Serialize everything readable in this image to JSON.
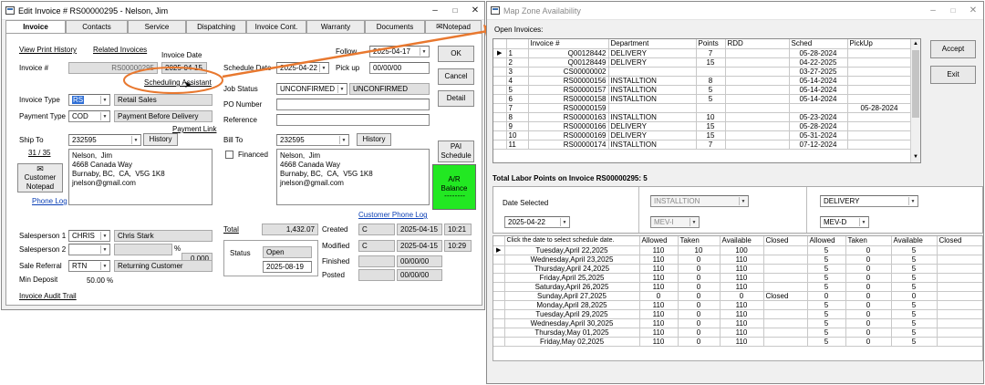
{
  "invoice_window": {
    "title": "Edit Invoice # RS00000295  -  Nelson, Jim",
    "tabs": [
      "Invoice",
      "Contacts",
      "Service",
      "Dispatching",
      "Invoice Cont.",
      "Warranty",
      "Documents",
      "Notepad"
    ],
    "links": {
      "view_print_history": "View Print History",
      "related_invoices": "Related Invoices",
      "scheduling_assistant": "Scheduling Assistant",
      "payment_link": "Payment Link",
      "phone_log": "Phone Log",
      "customer_phone_log": "Customer Phone Log",
      "invoice_audit_trail": "Invoice Audit Trail"
    },
    "labels": {
      "invoice_date": "Invoice Date",
      "invoice_no": "Invoice #",
      "follow": "Follow",
      "pick_up": "Pick up",
      "schedule_date": "Schedule Date",
      "job_status": "Job Status",
      "po_number": "PO Number",
      "reference": "Reference",
      "invoice_type": "Invoice Type",
      "payment_type": "Payment Type",
      "ship_to": "Ship To",
      "ship_count": "31 / 35",
      "bill_to": "Bill To",
      "financed": "Financed",
      "salesperson1": "Salesperson 1",
      "salesperson2": "Salesperson 2",
      "sale_referral": "Sale Referral",
      "min_deposit": "Min Deposit",
      "percent": "%",
      "total": "Total",
      "status": "Status",
      "created": "Created",
      "modified": "Modified",
      "finished": "Finished",
      "posted": "Posted"
    },
    "values": {
      "invoice_no": "RS00000295",
      "invoice_date": "2025-04-15",
      "follow": "2025-04-17",
      "pick_up": "00/00/00",
      "schedule_date": "2025-04-22",
      "job_status": "UNCONFIRMED",
      "job_status_text": "UNCONFIRMED",
      "invoice_type_code": "RS",
      "invoice_type_name": "Retail Sales",
      "payment_type_code": "COD",
      "payment_type_name": "Payment Before Delivery",
      "ship_to_id": "232595",
      "bill_to_id": "232595",
      "ship_address": "Nelson,  Jim\n4668 Canada Way\nBurnaby, BC,  CA,  V5G 1K8\njnelson@gmail.com",
      "bill_address": "Nelson,  Jim\n4668 Canada Way\nBurnaby, BC,  CA,  V5G 1K8\njnelson@gmail.com",
      "salesperson1_code": "CHRIS",
      "salesperson1_name": "Chris Stark",
      "salesperson2_code": "",
      "salesperson2_name": "",
      "salesperson2_amount": "0.000",
      "sale_referral_code": "RTN",
      "sale_referral_name": "Returning Customer",
      "min_deposit": "50.00",
      "total": "1,432.07",
      "status": "Open",
      "status_date": "2025-08-19",
      "created_user": "C",
      "created_date": "2025-04-15",
      "created_time": "10:21",
      "modified_user": "C",
      "modified_date": "2025-04-15",
      "modified_time": "10:29",
      "finished_date": "00/00/00",
      "posted_date": "00/00/00"
    },
    "buttons": {
      "ok": "OK",
      "cancel": "Cancel",
      "detail": "Detail",
      "history": "History",
      "customer_notepad": "Customer\nNotepad",
      "pai_schedule": "PAI\nSchedule",
      "ar_balance": "A/R\nBalance"
    },
    "colors": {
      "ar_balance_bg": "#22e822",
      "link": "#0b3fb5",
      "highlight_circle": "#e8782f"
    }
  },
  "zone_window": {
    "title": "Map Zone Availability",
    "open_invoices_label": "Open Invoices:",
    "columns": [
      "Invoice #",
      "Department",
      "Points",
      "RDD",
      "Sched",
      "PickUp"
    ],
    "rows": [
      [
        "1",
        "Q00128442",
        "DELIVERY",
        "7",
        "",
        "05-28-2024",
        ""
      ],
      [
        "2",
        "Q00128449",
        "DELIVERY",
        "15",
        "",
        "04-22-2025",
        ""
      ],
      [
        "3",
        "CS00000002",
        "",
        "",
        "",
        "03-27-2025",
        ""
      ],
      [
        "4",
        "RS00000156",
        "INSTALLTION",
        "8",
        "",
        "05-14-2024",
        ""
      ],
      [
        "5",
        "RS00000157",
        "INSTALLTION",
        "5",
        "",
        "05-14-2024",
        ""
      ],
      [
        "6",
        "RS00000158",
        "INSTALLTION",
        "5",
        "",
        "05-14-2024",
        ""
      ],
      [
        "7",
        "RS00000159",
        "",
        "",
        "",
        "",
        "05-28-2024"
      ],
      [
        "8",
        "RS00000163",
        "INSTALLTION",
        "10",
        "",
        "05-23-2024",
        ""
      ],
      [
        "9",
        "RS00000166",
        "DELIVERY",
        "15",
        "",
        "05-28-2024",
        ""
      ],
      [
        "10",
        "RS00000169",
        "DELIVERY",
        "15",
        "",
        "05-31-2024",
        ""
      ],
      [
        "11",
        "RS00000174",
        "INSTALLTION",
        "7",
        "",
        "07-12-2024",
        ""
      ]
    ],
    "buttons": {
      "accept": "Accept",
      "exit": "Exit"
    },
    "total_points_label": "Total Labor Points on Invoice RS00000295: 5",
    "date_selected_label": "Date Selected",
    "date_selected": "2025-04-22",
    "dept1": "INSTALLTION",
    "zone1": "MEV-I",
    "dept2": "DELIVERY",
    "zone2": "MEV-D",
    "sched_columns": [
      "Click the date to select schedule date.",
      "Allowed",
      "Taken",
      "Available",
      "Closed",
      "Allowed",
      "Taken",
      "Available",
      "Closed"
    ],
    "sched_rows": [
      [
        "Tuesday,April 22,2025",
        "110",
        "10",
        "100",
        "",
        "5",
        "0",
        "5",
        ""
      ],
      [
        "Wednesday,April 23,2025",
        "110",
        "0",
        "110",
        "",
        "5",
        "0",
        "5",
        ""
      ],
      [
        "Thursday,April 24,2025",
        "110",
        "0",
        "110",
        "",
        "5",
        "0",
        "5",
        ""
      ],
      [
        "Friday,April 25,2025",
        "110",
        "0",
        "110",
        "",
        "5",
        "0",
        "5",
        ""
      ],
      [
        "Saturday,April 26,2025",
        "110",
        "0",
        "110",
        "",
        "5",
        "0",
        "5",
        ""
      ],
      [
        "Sunday,April 27,2025",
        "0",
        "0",
        "0",
        "Closed",
        "0",
        "0",
        "0",
        ""
      ],
      [
        "Monday,April 28,2025",
        "110",
        "0",
        "110",
        "",
        "5",
        "0",
        "5",
        ""
      ],
      [
        "Tuesday,April 29,2025",
        "110",
        "0",
        "110",
        "",
        "5",
        "0",
        "5",
        ""
      ],
      [
        "Wednesday,April 30,2025",
        "110",
        "0",
        "110",
        "",
        "5",
        "0",
        "5",
        ""
      ],
      [
        "Thursday,May 01,2025",
        "110",
        "0",
        "110",
        "",
        "5",
        "0",
        "5",
        ""
      ],
      [
        "Friday,May 02,2025",
        "110",
        "0",
        "110",
        "",
        "5",
        "0",
        "5",
        ""
      ]
    ]
  }
}
